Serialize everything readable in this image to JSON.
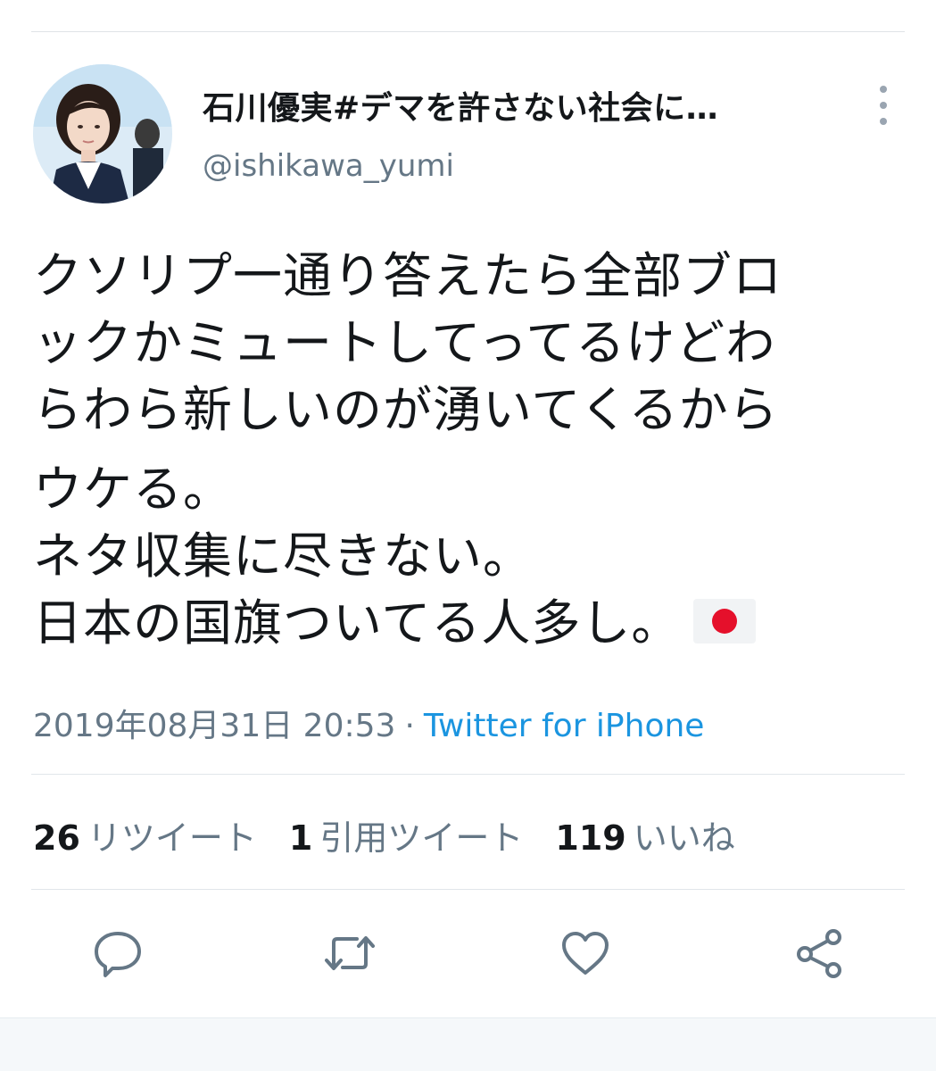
{
  "tweet": {
    "author": {
      "display_name": "石川優実#デマを許さない社会に…",
      "handle": "@ishikawa_yumi",
      "avatar_icon": "profile-photo"
    },
    "text_lines": [
      "クソリプ一通り答えたら全部ブロ",
      "ックかミュートしてってるけどわ",
      "らわら新しいのが湧いてくるから",
      "ウケる。",
      "ネタ収集に尽きない。",
      "日本の国旗ついてる人多し。"
    ],
    "emoji": "flag-japan",
    "timestamp": "2019年08月31日 20:53",
    "separator": "·",
    "source": "Twitter for iPhone",
    "stats": {
      "retweets_count": "26",
      "retweets_label": "リツイート",
      "quotes_count": "1",
      "quotes_label": "引用ツイート",
      "likes_count": "119",
      "likes_label": "いいね"
    }
  },
  "actions": [
    {
      "icon": "reply-icon"
    },
    {
      "icon": "retweet-icon"
    },
    {
      "icon": "like-icon"
    },
    {
      "icon": "share-icon"
    }
  ],
  "colors": {
    "text": "#14171a",
    "secondary": "#657786",
    "link": "#1b95e0",
    "icon": "#657786"
  }
}
